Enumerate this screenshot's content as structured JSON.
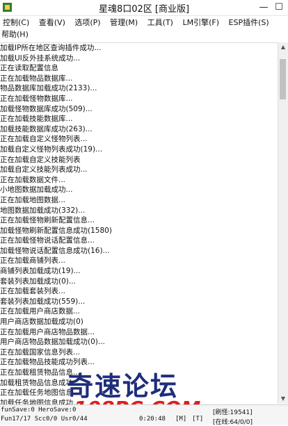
{
  "window": {
    "title": "星魂8口02区 [商业版]",
    "minimize": "—",
    "maximize": "☐"
  },
  "menu": {
    "row1": [
      "控制(C)",
      "查看(V)",
      "选项(P)",
      "管理(M)",
      "工具(T)",
      "LM引擎(F)",
      "ESP插件(S)"
    ],
    "row2": [
      "帮助(H)"
    ]
  },
  "log": [
    "加载IP所在地区查询插件成功...",
    "加载UI反外挂系统成功...",
    "正在读取配置信息",
    "正在加载物品数据库...",
    "物品数据库加载成功(2133)...",
    "正在加载怪物数据库...",
    "加载怪物数据库成功(509)...",
    "正在加载技能数据库...",
    "加载技能数据库成功(263)...",
    "正在加载自定义怪物列表...",
    "加载自定义怪物列表成功(19)...",
    "正在加载自定义技能列表",
    "加载自定义技能列表成功...",
    "正在加载数据文件...",
    "小地图数据加载成功...",
    "正在加载地图数据...",
    "地图数据加载成功(332)...",
    "正在加载怪物刷新配置信息...",
    "加载怪物刷新配置信息成功(1580)",
    "正在加载怪物说话配置信息...",
    "加载怪物说话配置信息成功(16)...",
    "正在加载商铺列表...",
    "商铺列表加载成功(19)...",
    "套装列表加载成功(0)...",
    "正在加载套装列表...",
    "套装列表加载成功(559)...",
    "正在加载用户商店数据...",
    "用户商店数据加载成功(0)",
    "正在加载用户商店物品数据...",
    "用户商店物品数据加载成功(0)...",
    "正在加载国家信息列表...",
    "正在加载物品技能成功列表...",
    "正在加载租赁物品信息...",
    "加载租赁物品信息成功...",
    "正在加载任务地图信息...",
    "加载任务地图信息成功..."
  ],
  "status": {
    "line1": "funSave:0 HeroSave:0",
    "line2": "Fun17/17 Scc0/0 Usr0/44",
    "time": "0:20:48",
    "field1": "[M]",
    "field2": "[T]",
    "right1": "[刷怪:19541]",
    "right2": "[在线:64/0/0]"
  },
  "watermark": {
    "main": "奇速论坛",
    "sub": "108PC.COM"
  },
  "colors": {
    "watermark_main": "#1f2e7a",
    "watermark_sub": "#e31c1c"
  }
}
